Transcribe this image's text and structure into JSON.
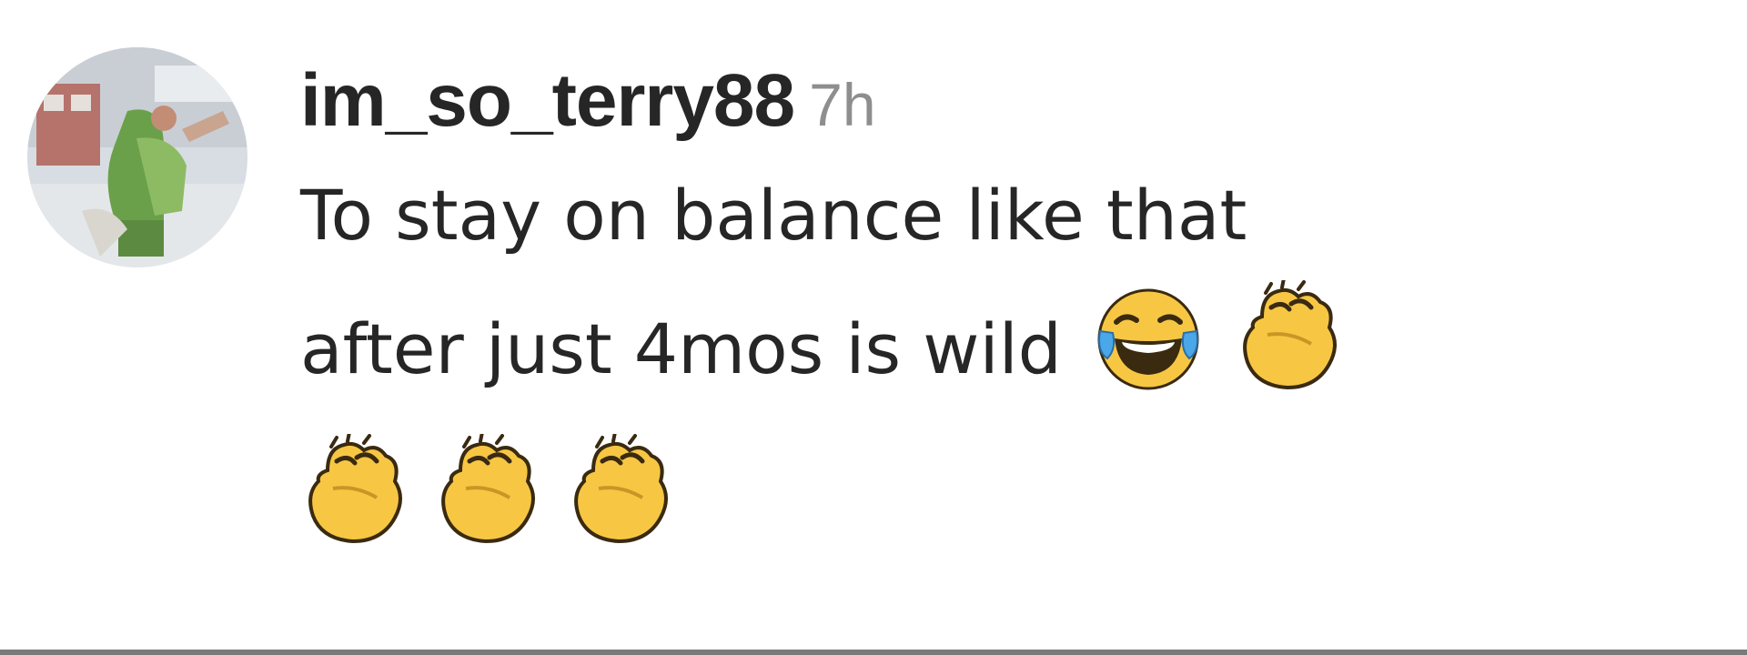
{
  "comment": {
    "avatar_icon": "user-avatar-photo",
    "username": "im_so_terry88",
    "timestamp": "7h",
    "text_line1": "To stay on balance like that",
    "text_line2": "after just 4mos is wild",
    "emojis": [
      "face-with-tears-of-joy-emoji",
      "clapping-hands-emoji",
      "clapping-hands-emoji",
      "clapping-hands-emoji",
      "clapping-hands-emoji"
    ]
  },
  "colors": {
    "username": "#262626",
    "timestamp": "#8e8e8e",
    "text": "#262626",
    "emoji_yellow": "#f7c744",
    "emoji_outline": "#3a2a10",
    "divider": "#7a7a7a"
  }
}
